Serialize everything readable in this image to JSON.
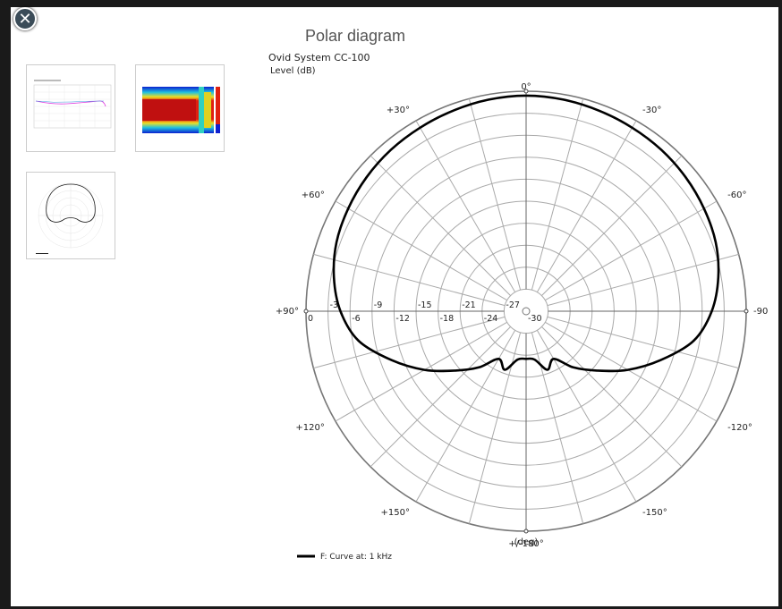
{
  "dialog": {
    "title": "Polar diagram",
    "close_glyph": "✕"
  },
  "thumbnails": [
    {
      "kind": "frequency-response-thumbnail"
    },
    {
      "kind": "heatmap-thumbnail"
    },
    {
      "kind": "polar-thumbnail"
    }
  ],
  "chart_data": {
    "type": "polar",
    "title": "Ovid System CC-100",
    "ylabel": "Level  (dB)",
    "angle_unit_label": "(deg)",
    "radial_ticks": [
      "0",
      "-3",
      "-6",
      "-9",
      "-12",
      "-15",
      "-18",
      "-21",
      "-24",
      "-27",
      "-30"
    ],
    "radial_range": [
      -30,
      0
    ],
    "angle_labels": [
      {
        "deg": 0,
        "text": "0°"
      },
      {
        "deg": 30,
        "text": "+30°"
      },
      {
        "deg": -30,
        "text": "-30°"
      },
      {
        "deg": 60,
        "text": "+60°"
      },
      {
        "deg": -60,
        "text": "-60°"
      },
      {
        "deg": 90,
        "text": "+90°"
      },
      {
        "deg": -90,
        "text": "-90°"
      },
      {
        "deg": 120,
        "text": "+120°"
      },
      {
        "deg": -120,
        "text": "-120°"
      },
      {
        "deg": 150,
        "text": "+150°"
      },
      {
        "deg": -150,
        "text": "-150°"
      },
      {
        "deg": 180,
        "text": "+/-180°"
      }
    ],
    "series": [
      {
        "name": "F: Curve at: 1 kHz",
        "color": "#000000",
        "angles": [
          0,
          10,
          20,
          30,
          40,
          50,
          60,
          70,
          80,
          90,
          100,
          110,
          120,
          130,
          140,
          150,
          160,
          170,
          180,
          190,
          200,
          210,
          220,
          230,
          240,
          250,
          260,
          270,
          280,
          290,
          300,
          310,
          320,
          330,
          340,
          350
        ],
        "values": [
          -0.6,
          -0.7,
          -0.9,
          -1.1,
          -1.3,
          -1.6,
          -2,
          -2.5,
          -3.4,
          -4.7,
          -6.8,
          -10.5,
          -14,
          -17.4,
          -20,
          -22.5,
          -21.5,
          -23.3,
          -23.5,
          -23.3,
          -21.5,
          -22.5,
          -20,
          -17.4,
          -14,
          -10.5,
          -6.8,
          -4.7,
          -3.4,
          -2.5,
          -2,
          -1.6,
          -1.3,
          -1.1,
          -0.9,
          -0.7
        ]
      }
    ],
    "grid": true
  }
}
